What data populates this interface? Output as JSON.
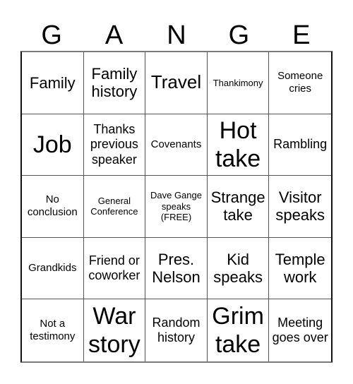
{
  "header": {
    "letters": [
      "G",
      "A",
      "N",
      "G",
      "E"
    ]
  },
  "cells": [
    {
      "text": "Family",
      "size": "m"
    },
    {
      "text": "Family history",
      "size": "m"
    },
    {
      "text": "Travel",
      "size": "l"
    },
    {
      "text": "Thankimony",
      "size": "xs"
    },
    {
      "text": "Someone cries",
      "size": "s"
    },
    {
      "text": "Job",
      "size": "xl"
    },
    {
      "text": "Thanks previous speaker",
      "size": "sm"
    },
    {
      "text": "Covenants",
      "size": "s"
    },
    {
      "text": "Hot take",
      "size": "xl"
    },
    {
      "text": "Rambling",
      "size": "sm"
    },
    {
      "text": "No conclusion",
      "size": "s"
    },
    {
      "text": "General Conference",
      "size": "xs"
    },
    {
      "text": "Dave Gange speaks (FREE)",
      "size": "xxs",
      "free": true
    },
    {
      "text": "Strange take",
      "size": "m"
    },
    {
      "text": "Visitor speaks",
      "size": "m"
    },
    {
      "text": "Grandkids",
      "size": "s"
    },
    {
      "text": "Friend or coworker",
      "size": "sm"
    },
    {
      "text": "Pres. Nelson",
      "size": "m"
    },
    {
      "text": "Kid speaks",
      "size": "m"
    },
    {
      "text": "Temple work",
      "size": "m"
    },
    {
      "text": "Not a testimony",
      "size": "s"
    },
    {
      "text": "War story",
      "size": "xl"
    },
    {
      "text": "Random history",
      "size": "sm"
    },
    {
      "text": "Grim take",
      "size": "xl"
    },
    {
      "text": "Meeting goes over",
      "size": "sm"
    }
  ]
}
